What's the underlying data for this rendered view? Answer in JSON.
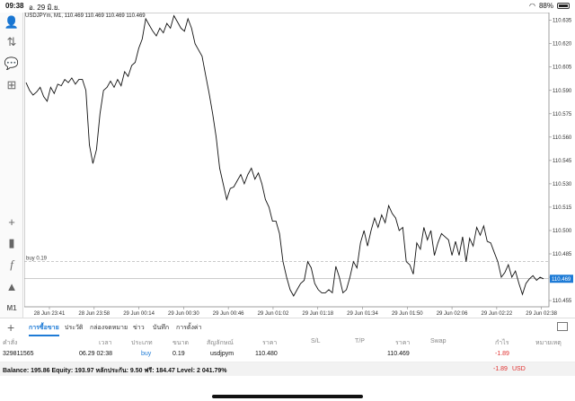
{
  "status": {
    "time": "09:38",
    "date": "อ. 29 มิ.ย.",
    "battery": "88%"
  },
  "chart": {
    "title": "USDJPYm, M1, 110.469 110.469 110.469 110.469",
    "order_label": "buy 0.19",
    "current_price": "110.469",
    "y_ticks": [
      "110.635",
      "110.620",
      "110.605",
      "110.590",
      "110.575",
      "110.560",
      "110.545",
      "110.530",
      "110.515",
      "110.500",
      "110.485",
      "110.470",
      "110.455"
    ],
    "x_ticks": [
      "28 Jun 23:41",
      "28 Jun 23:58",
      "29 Jun 00:14",
      "29 Jun 00:30",
      "29 Jun 00:46",
      "29 Jun 01:02",
      "29 Jun 01:18",
      "29 Jun 01:34",
      "29 Jun 01:50",
      "29 Jun 02:06",
      "29 Jun 02:22",
      "29 Jun 02:38"
    ],
    "price_series": [
      110.595,
      110.59,
      110.587,
      110.589,
      110.592,
      110.586,
      110.583,
      110.592,
      110.588,
      110.594,
      110.593,
      110.597,
      110.595,
      110.598,
      110.594,
      110.597,
      110.597,
      110.59,
      110.555,
      110.543,
      110.552,
      110.575,
      110.59,
      110.592,
      110.596,
      110.592,
      110.597,
      110.593,
      110.602,
      110.599,
      110.606,
      110.608,
      110.617,
      110.623,
      110.636,
      110.632,
      110.628,
      110.625,
      110.63,
      110.627,
      110.633,
      110.63,
      110.638,
      110.634,
      110.63,
      110.628,
      110.636,
      110.63,
      110.62,
      110.616,
      110.612,
      110.6,
      110.588,
      110.575,
      110.56,
      110.54,
      110.53,
      110.52,
      110.527,
      110.528,
      110.532,
      110.536,
      110.53,
      110.536,
      110.54,
      110.533,
      110.537,
      110.53,
      110.52,
      110.515,
      110.506,
      110.506,
      110.498,
      110.48,
      110.47,
      110.462,
      110.458,
      110.462,
      110.466,
      110.468,
      110.48,
      110.476,
      110.466,
      110.462,
      110.46,
      110.46,
      110.462,
      110.46,
      110.477,
      110.47,
      110.46,
      110.462,
      110.47,
      110.48,
      110.476,
      110.492,
      110.5,
      110.49,
      110.5,
      110.508,
      110.502,
      110.51,
      110.505,
      110.516,
      110.511,
      110.508,
      110.5,
      110.502,
      110.48,
      110.478,
      110.472,
      110.492,
      110.488,
      110.502,
      110.494,
      110.5,
      110.484,
      110.492,
      110.498,
      110.496,
      110.494,
      110.484,
      110.493,
      110.484,
      110.496,
      110.48,
      110.495,
      110.49,
      110.502,
      110.497,
      110.503,
      110.493,
      110.492,
      110.486,
      110.48,
      110.47,
      110.473,
      110.478,
      110.47,
      110.474,
      110.466,
      110.459,
      110.466,
      110.469,
      110.471,
      110.468,
      110.47,
      110.469
    ]
  },
  "toolbar": {
    "timeframe": "M1"
  },
  "tabs": [
    "การซื้อขาย",
    "ประวัติ",
    "กล่องจดหมาย",
    "ข่าว",
    "บันทึก",
    "การตั้งค่า"
  ],
  "table": {
    "headers": [
      "คำสั่ง",
      "เวลา",
      "ประเภท",
      "ขนาด",
      "สัญลักษณ์",
      "ราคา",
      "S/L",
      "T/P",
      "ราคา",
      "Swap",
      "กำไร",
      "หมายเหตุ"
    ],
    "row": {
      "ticket": "329811565",
      "time": "06.29 02:38",
      "type": "buy",
      "size": "0.19",
      "symbol": "usdjpym",
      "price": "110.480",
      "current": "110.469",
      "profit": "-1.89"
    }
  },
  "balance": {
    "text": "Balance: 195.86 Equity: 193.97 หลักประกัน: 9.50 ฟรี: 184.47 Level: 2 041.79%",
    "pl": "-1.89",
    "currency": "USD"
  },
  "colors": {
    "accent": "#1e7bd6",
    "loss": "#e0302f",
    "buy_link": "#1e7bd6"
  }
}
